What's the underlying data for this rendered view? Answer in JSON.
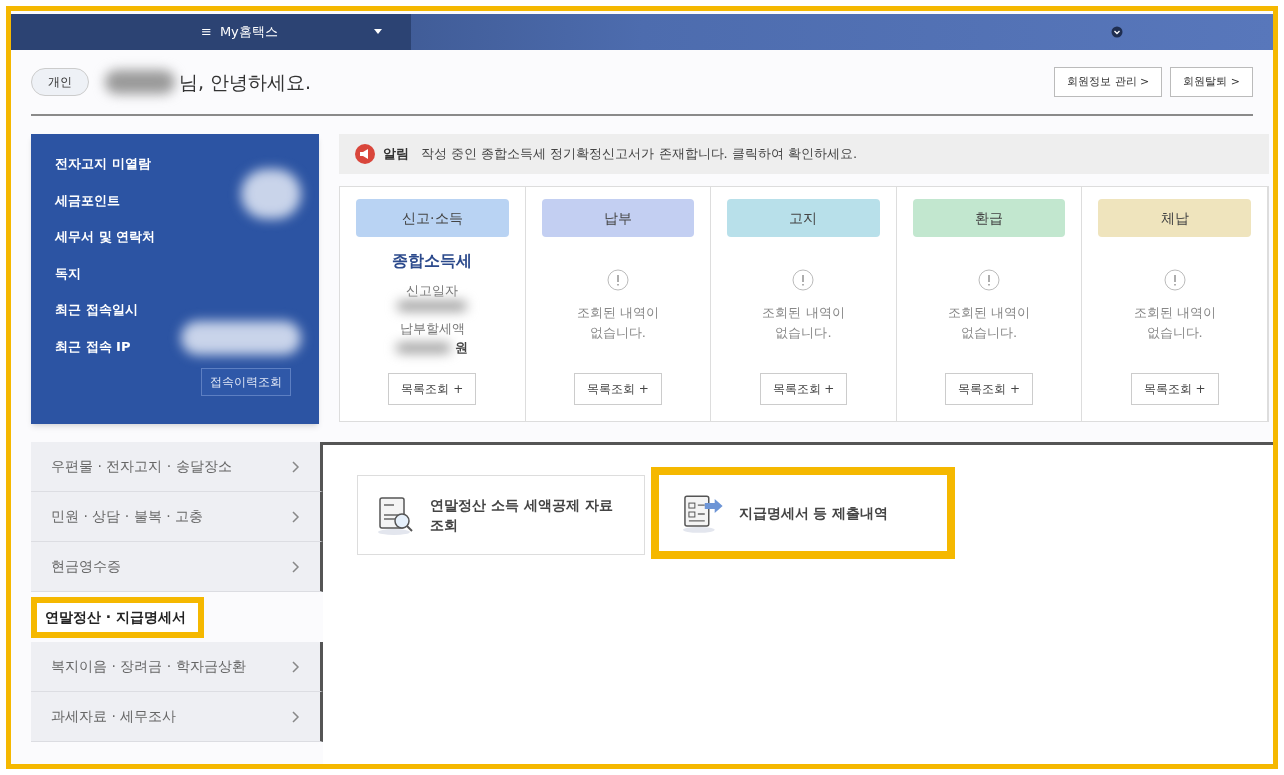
{
  "top_bar": {
    "menu_glyph": "≡",
    "title": "My홈택스"
  },
  "greeting": {
    "badge": "개인",
    "text": "님, 안녕하세요.",
    "buttons": [
      "회원정보 관리 >",
      "회원탈퇴 >"
    ]
  },
  "profile": {
    "items": [
      "전자고지 미열람",
      "세금포인트",
      "세무서 및 연락처",
      "독지",
      "최근 접속일시",
      "최근 접속 IP"
    ],
    "button": "접속이력조회"
  },
  "alert": {
    "label": "알림",
    "text": "작성 중인 종합소득세 정기확정신고서가 존재합니다. 클릭하여 확인하세요."
  },
  "status_cards": [
    {
      "kind": "filed",
      "title": "신고·소득",
      "color": "#b9d3f3",
      "tax": "종합소득세",
      "date_label": "신고일자",
      "amount_label": "납부할세액",
      "amount_unit": "원",
      "button": "목록조회 +"
    },
    {
      "kind": "empty",
      "title": "납부",
      "color": "#c3cff2",
      "message": "조회된 내역이 없습니다.",
      "button": "목록조회 +"
    },
    {
      "kind": "empty",
      "title": "고지",
      "color": "#b8e0ea",
      "message": "조회된 내역이 없습니다.",
      "button": "목록조회 +"
    },
    {
      "kind": "empty",
      "title": "환급",
      "color": "#c2e7cf",
      "message": "조회된 내역이 없습니다.",
      "button": "목록조회 +"
    },
    {
      "kind": "empty",
      "title": "체납",
      "color": "#efe4bd",
      "message": "조회된 내역이 없습니다.",
      "button": "목록조회 +"
    }
  ],
  "sidebar": {
    "items": [
      {
        "label": "우편물 · 전자고지 · 송달장소",
        "selected": false
      },
      {
        "label": "민원 · 상담 · 불복 · 고충",
        "selected": false
      },
      {
        "label": "현금영수증",
        "selected": false
      },
      {
        "label": "연말정산 · 지급명세서",
        "selected": true
      },
      {
        "label": "복지이음 · 장려금 · 학자금상환",
        "selected": false
      },
      {
        "label": "과세자료 · 세무조사",
        "selected": false
      }
    ]
  },
  "shortcuts": [
    {
      "kind": "search",
      "label": "연말정산 소득 세액공제 자료 조회",
      "highlighted": false
    },
    {
      "kind": "submit",
      "label": "지급명세서 등 제출내역",
      "highlighted": true
    }
  ]
}
